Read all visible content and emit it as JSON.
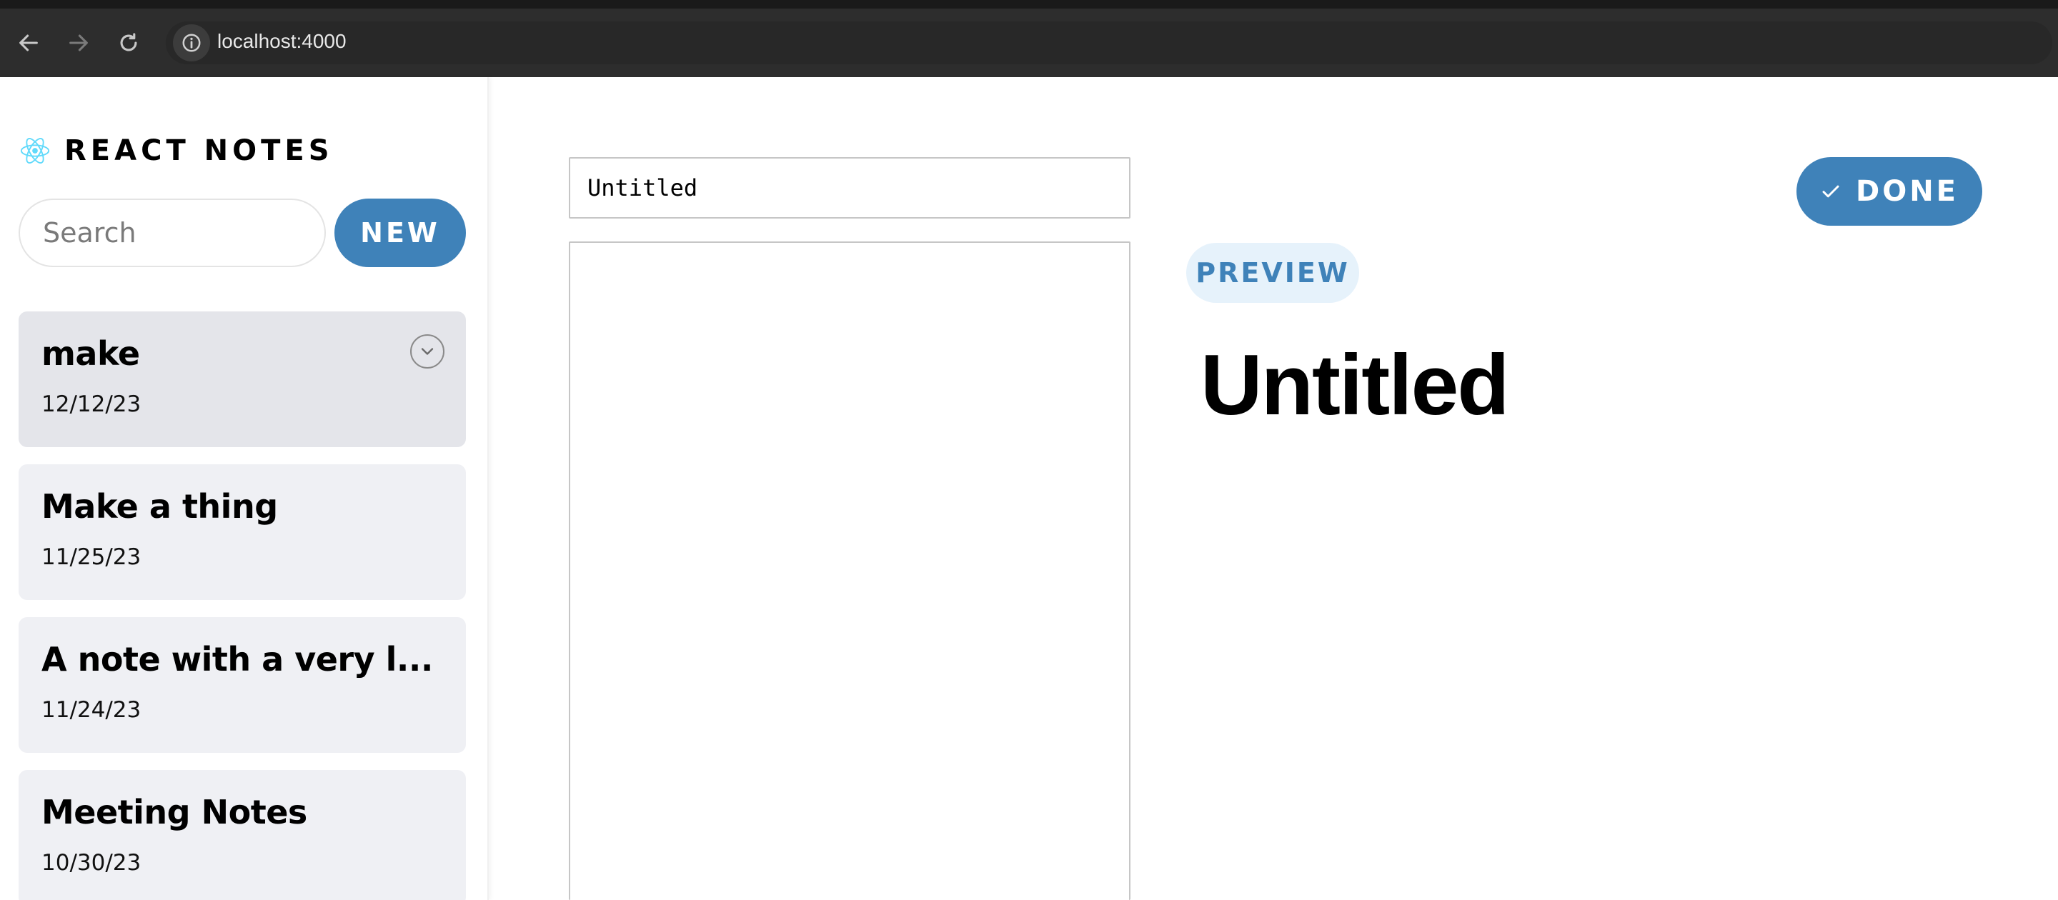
{
  "browser": {
    "url": "localhost:4000",
    "icons": [
      "back-arrow-icon",
      "forward-arrow-icon",
      "reload-icon",
      "info-icon"
    ]
  },
  "sidebar": {
    "logo_text": "REACT NOTES",
    "logo_icon": "react-logo-icon",
    "search_placeholder": "Search",
    "new_label": "NEW",
    "notes": [
      {
        "title": "make",
        "date": "12/12/23",
        "active": true
      },
      {
        "title": "Make a thing",
        "date": "11/25/23",
        "active": false
      },
      {
        "title": "A note with a very l...",
        "date": "11/24/23",
        "active": false
      },
      {
        "title": "Meeting Notes",
        "date": "10/30/23",
        "active": false
      }
    ]
  },
  "editor": {
    "title_value": "Untitled",
    "body_value": "",
    "done_label": "DONE",
    "done_icon": "check-icon",
    "preview_label": "PREVIEW",
    "preview_title": "Untitled"
  },
  "colors": {
    "accent": "#3f82b9",
    "note_bg": "#eff0f4",
    "note_active_bg": "#e4e5ea",
    "preview_badge_bg": "#e6f2fb"
  }
}
